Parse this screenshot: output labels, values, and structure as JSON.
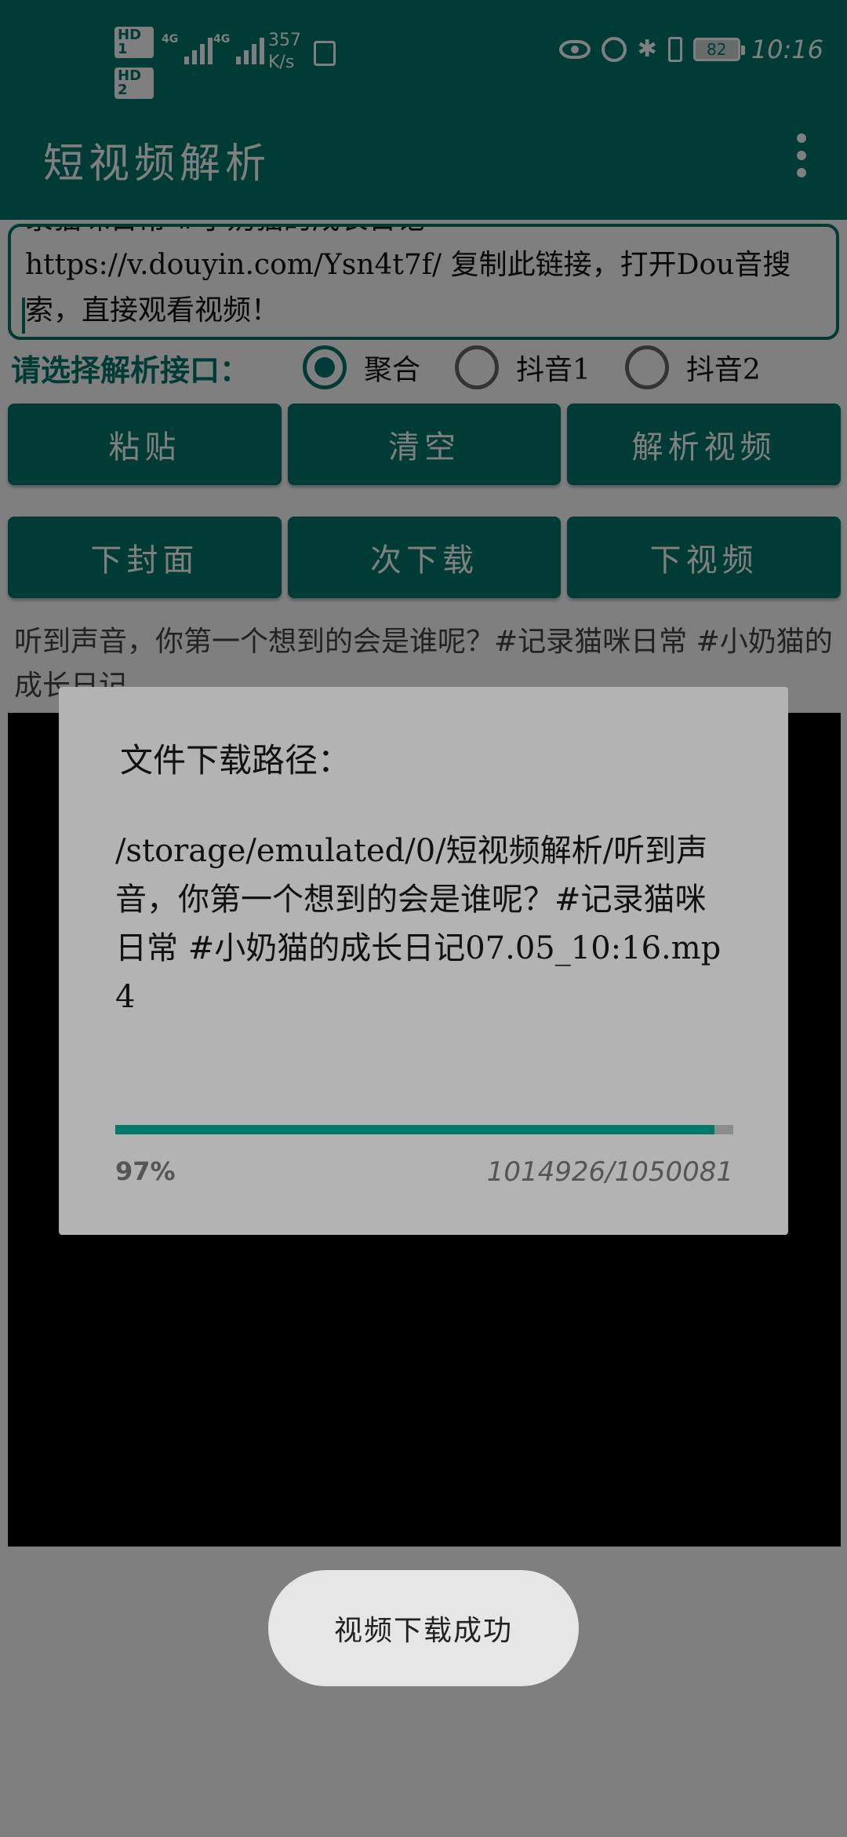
{
  "status_bar": {
    "hd1": "HD 1",
    "hd2": "HD 2",
    "net1": "4G",
    "net2": "4G",
    "speed_value": "357",
    "speed_unit": "K/s",
    "battery": "82",
    "time": "10:16",
    "icons": [
      "eye-icon",
      "alarm-icon",
      "bluetooth-icon",
      "vibrate-icon",
      "battery-icon"
    ]
  },
  "appbar": {
    "title": "短视频解析"
  },
  "url_input": {
    "line0": "录猫咪日常 #小奶猫的成长日记",
    "line1": "https://v.douyin.com/Ysn4t7f/ 复制此链接，打开Dou音搜",
    "line2": "索，直接观看视频！"
  },
  "interface": {
    "label": "请选择解析接口：",
    "options": [
      "聚合",
      "抖音1",
      "抖音2"
    ],
    "selected": "聚合"
  },
  "buttons_row1": [
    "粘贴",
    "清空",
    "解析视频"
  ],
  "buttons_row2": [
    "下封面",
    "次下载",
    "下视频"
  ],
  "caption": "听到声音，你第一个想到的会是谁呢？#记录猫咪日常 #小奶猫的成长日记",
  "dialog": {
    "title": "文件下载路径：",
    "message": "/storage/emulated/0/短视频解析/听到声音，你第一个想到的会是谁呢？#记录猫咪日常 #小奶猫的成长日记07.05_10:16.mp4",
    "progress_fraction": 0.97,
    "progress_percent": "97%",
    "progress_count": "1014926/1050081"
  },
  "toast": "视频下载成功",
  "colors": {
    "primary": "#00796b",
    "dialog_bg": "#b3b3b3",
    "toast_bg": "#e6e6e6"
  }
}
